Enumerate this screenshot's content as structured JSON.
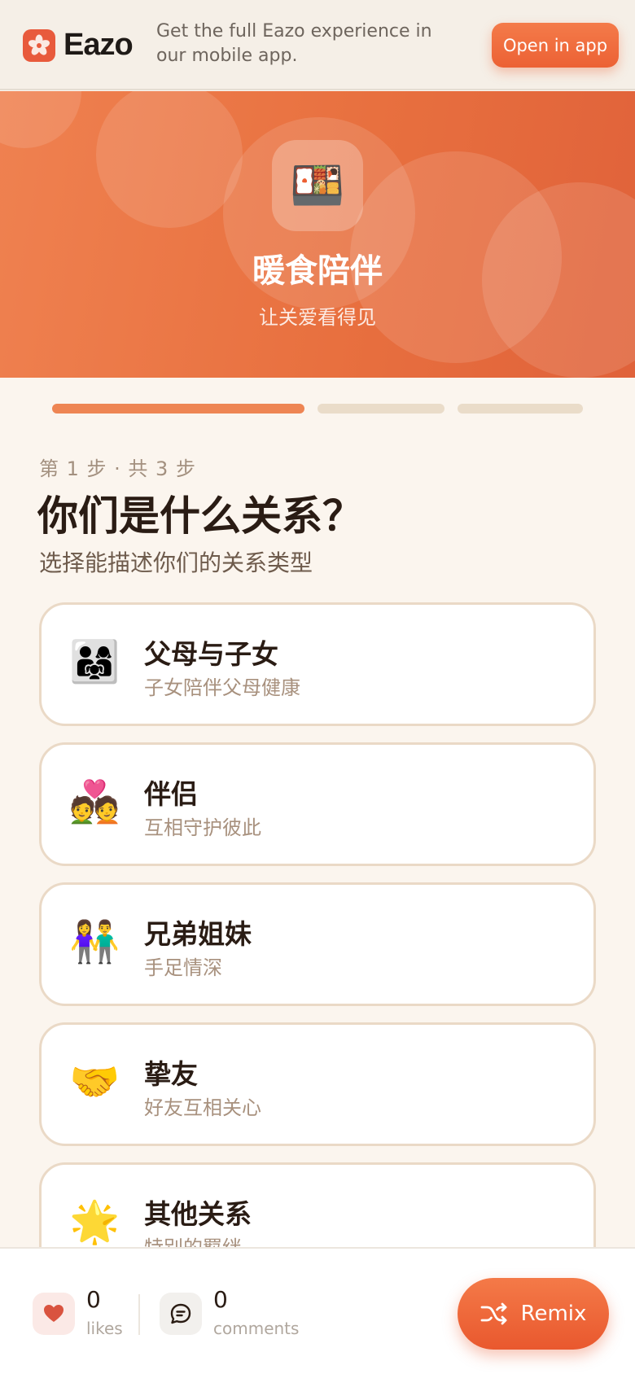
{
  "banner": {
    "brand": "Eazo",
    "message": "Get the full Eazo experience in our mobile app.",
    "open_button": "Open in app"
  },
  "hero": {
    "icon_emoji": "🍱",
    "title": "暖食陪伴",
    "subtitle": "让关爱看得见"
  },
  "progress": {
    "current_step": 1,
    "total_steps": 3
  },
  "step": {
    "label": "第 1 步 · 共 3 步",
    "question": "你们是什么关系？",
    "subtitle": "选择能描述你们的关系类型"
  },
  "options": [
    {
      "emoji": "👨‍👩‍👧",
      "title": "父母与子女",
      "desc": "子女陪伴父母健康"
    },
    {
      "emoji": "💑",
      "title": "伴侣",
      "desc": "互相守护彼此"
    },
    {
      "emoji": "👫",
      "title": "兄弟姐妹",
      "desc": "手足情深"
    },
    {
      "emoji": "🤝",
      "title": "挚友",
      "desc": "好友互相关心"
    },
    {
      "emoji": "🌟",
      "title": "其他关系",
      "desc": "特别的羁绊"
    }
  ],
  "footer": {
    "likes_count": "0",
    "likes_label": "likes",
    "comments_count": "0",
    "comments_label": "comments",
    "remix_label": "Remix"
  },
  "colors": {
    "accent": "#ee6a3a",
    "background": "#fbf5ee"
  }
}
